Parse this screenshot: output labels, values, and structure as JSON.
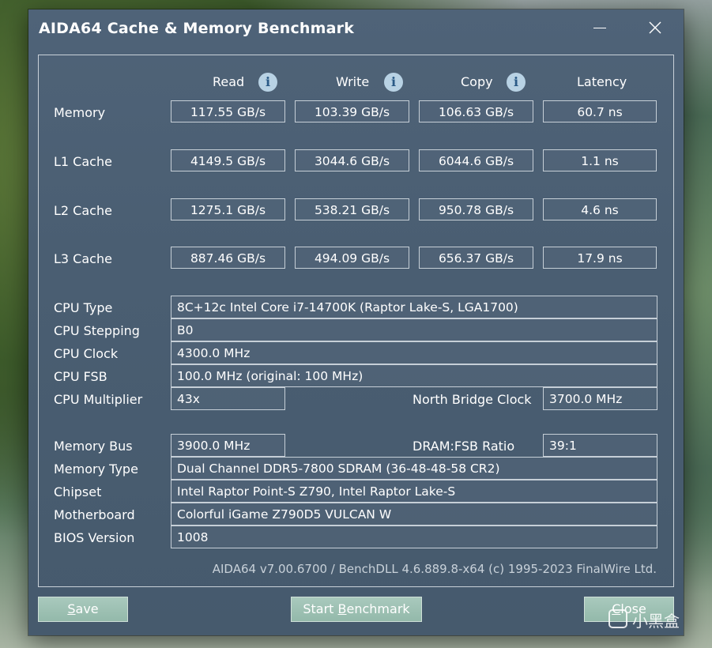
{
  "window": {
    "title": "AIDA64 Cache & Memory Benchmark",
    "minimize_glyph": "—",
    "close_glyph": "✕"
  },
  "columns": {
    "read": "Read",
    "write": "Write",
    "copy": "Copy",
    "latency": "Latency",
    "info_glyph": "i"
  },
  "benchmark_rows": [
    {
      "label": "Memory",
      "read": "117.55 GB/s",
      "write": "103.39 GB/s",
      "copy": "106.63 GB/s",
      "latency": "60.7 ns"
    },
    {
      "label": "L1 Cache",
      "read": "4149.5 GB/s",
      "write": "3044.6 GB/s",
      "copy": "6044.6 GB/s",
      "latency": "1.1 ns"
    },
    {
      "label": "L2 Cache",
      "read": "1275.1 GB/s",
      "write": "538.21 GB/s",
      "copy": "950.78 GB/s",
      "latency": "4.6 ns"
    },
    {
      "label": "L3 Cache",
      "read": "887.46 GB/s",
      "write": "494.09 GB/s",
      "copy": "656.37 GB/s",
      "latency": "17.9 ns"
    }
  ],
  "info": {
    "cpu_type": {
      "label": "CPU Type",
      "value": "8C+12c Intel Core i7-14700K  (Raptor Lake-S, LGA1700)"
    },
    "cpu_stepping": {
      "label": "CPU Stepping",
      "value": "B0"
    },
    "cpu_clock": {
      "label": "CPU Clock",
      "value": "4300.0 MHz"
    },
    "cpu_fsb": {
      "label": "CPU FSB",
      "value": "100.0 MHz  (original: 100 MHz)"
    },
    "cpu_multiplier": {
      "label": "CPU Multiplier",
      "value": "43x"
    },
    "north_bridge": {
      "label": "North Bridge Clock",
      "value": "3700.0 MHz"
    },
    "memory_bus": {
      "label": "Memory Bus",
      "value": "3900.0 MHz"
    },
    "dram_fsb": {
      "label": "DRAM:FSB Ratio",
      "value": "39:1"
    },
    "memory_type": {
      "label": "Memory Type",
      "value": "Dual Channel DDR5-7800 SDRAM  (36-48-48-58 CR2)"
    },
    "chipset": {
      "label": "Chipset",
      "value": "Intel Raptor Point-S Z790, Intel Raptor Lake-S"
    },
    "motherboard": {
      "label": "Motherboard",
      "value": "Colorful iGame Z790D5 VULCAN W"
    },
    "bios": {
      "label": "BIOS Version",
      "value": "1008"
    }
  },
  "footer": {
    "version": "AIDA64 v7.00.6700 / BenchDLL 4.6.889.8-x64  (c) 1995-2023 FinalWire Ltd."
  },
  "buttons": {
    "save_mnemonic": "S",
    "save_rest": "ave",
    "start_prefix": "Start ",
    "start_mnemonic": "B",
    "start_rest": "enchmark",
    "close_mnemonic": "C",
    "close_rest": "lose"
  },
  "watermark": {
    "text": "小黑盒"
  }
}
